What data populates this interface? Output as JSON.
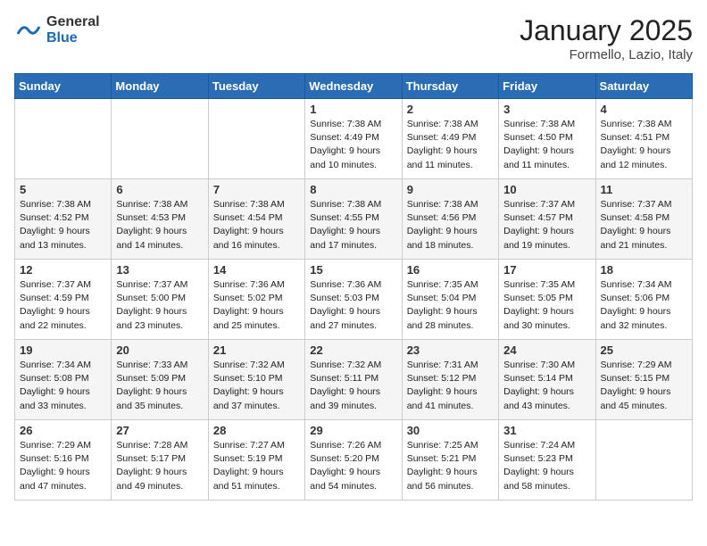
{
  "logo": {
    "general": "General",
    "blue": "Blue"
  },
  "title": "January 2025",
  "location": "Formello, Lazio, Italy",
  "days_of_week": [
    "Sunday",
    "Monday",
    "Tuesday",
    "Wednesday",
    "Thursday",
    "Friday",
    "Saturday"
  ],
  "weeks": [
    [
      {
        "day": "",
        "info": ""
      },
      {
        "day": "",
        "info": ""
      },
      {
        "day": "",
        "info": ""
      },
      {
        "day": "1",
        "info": "Sunrise: 7:38 AM\nSunset: 4:49 PM\nDaylight: 9 hours\nand 10 minutes."
      },
      {
        "day": "2",
        "info": "Sunrise: 7:38 AM\nSunset: 4:49 PM\nDaylight: 9 hours\nand 11 minutes."
      },
      {
        "day": "3",
        "info": "Sunrise: 7:38 AM\nSunset: 4:50 PM\nDaylight: 9 hours\nand 11 minutes."
      },
      {
        "day": "4",
        "info": "Sunrise: 7:38 AM\nSunset: 4:51 PM\nDaylight: 9 hours\nand 12 minutes."
      }
    ],
    [
      {
        "day": "5",
        "info": "Sunrise: 7:38 AM\nSunset: 4:52 PM\nDaylight: 9 hours\nand 13 minutes."
      },
      {
        "day": "6",
        "info": "Sunrise: 7:38 AM\nSunset: 4:53 PM\nDaylight: 9 hours\nand 14 minutes."
      },
      {
        "day": "7",
        "info": "Sunrise: 7:38 AM\nSunset: 4:54 PM\nDaylight: 9 hours\nand 16 minutes."
      },
      {
        "day": "8",
        "info": "Sunrise: 7:38 AM\nSunset: 4:55 PM\nDaylight: 9 hours\nand 17 minutes."
      },
      {
        "day": "9",
        "info": "Sunrise: 7:38 AM\nSunset: 4:56 PM\nDaylight: 9 hours\nand 18 minutes."
      },
      {
        "day": "10",
        "info": "Sunrise: 7:37 AM\nSunset: 4:57 PM\nDaylight: 9 hours\nand 19 minutes."
      },
      {
        "day": "11",
        "info": "Sunrise: 7:37 AM\nSunset: 4:58 PM\nDaylight: 9 hours\nand 21 minutes."
      }
    ],
    [
      {
        "day": "12",
        "info": "Sunrise: 7:37 AM\nSunset: 4:59 PM\nDaylight: 9 hours\nand 22 minutes."
      },
      {
        "day": "13",
        "info": "Sunrise: 7:37 AM\nSunset: 5:00 PM\nDaylight: 9 hours\nand 23 minutes."
      },
      {
        "day": "14",
        "info": "Sunrise: 7:36 AM\nSunset: 5:02 PM\nDaylight: 9 hours\nand 25 minutes."
      },
      {
        "day": "15",
        "info": "Sunrise: 7:36 AM\nSunset: 5:03 PM\nDaylight: 9 hours\nand 27 minutes."
      },
      {
        "day": "16",
        "info": "Sunrise: 7:35 AM\nSunset: 5:04 PM\nDaylight: 9 hours\nand 28 minutes."
      },
      {
        "day": "17",
        "info": "Sunrise: 7:35 AM\nSunset: 5:05 PM\nDaylight: 9 hours\nand 30 minutes."
      },
      {
        "day": "18",
        "info": "Sunrise: 7:34 AM\nSunset: 5:06 PM\nDaylight: 9 hours\nand 32 minutes."
      }
    ],
    [
      {
        "day": "19",
        "info": "Sunrise: 7:34 AM\nSunset: 5:08 PM\nDaylight: 9 hours\nand 33 minutes."
      },
      {
        "day": "20",
        "info": "Sunrise: 7:33 AM\nSunset: 5:09 PM\nDaylight: 9 hours\nand 35 minutes."
      },
      {
        "day": "21",
        "info": "Sunrise: 7:32 AM\nSunset: 5:10 PM\nDaylight: 9 hours\nand 37 minutes."
      },
      {
        "day": "22",
        "info": "Sunrise: 7:32 AM\nSunset: 5:11 PM\nDaylight: 9 hours\nand 39 minutes."
      },
      {
        "day": "23",
        "info": "Sunrise: 7:31 AM\nSunset: 5:12 PM\nDaylight: 9 hours\nand 41 minutes."
      },
      {
        "day": "24",
        "info": "Sunrise: 7:30 AM\nSunset: 5:14 PM\nDaylight: 9 hours\nand 43 minutes."
      },
      {
        "day": "25",
        "info": "Sunrise: 7:29 AM\nSunset: 5:15 PM\nDaylight: 9 hours\nand 45 minutes."
      }
    ],
    [
      {
        "day": "26",
        "info": "Sunrise: 7:29 AM\nSunset: 5:16 PM\nDaylight: 9 hours\nand 47 minutes."
      },
      {
        "day": "27",
        "info": "Sunrise: 7:28 AM\nSunset: 5:17 PM\nDaylight: 9 hours\nand 49 minutes."
      },
      {
        "day": "28",
        "info": "Sunrise: 7:27 AM\nSunset: 5:19 PM\nDaylight: 9 hours\nand 51 minutes."
      },
      {
        "day": "29",
        "info": "Sunrise: 7:26 AM\nSunset: 5:20 PM\nDaylight: 9 hours\nand 54 minutes."
      },
      {
        "day": "30",
        "info": "Sunrise: 7:25 AM\nSunset: 5:21 PM\nDaylight: 9 hours\nand 56 minutes."
      },
      {
        "day": "31",
        "info": "Sunrise: 7:24 AM\nSunset: 5:23 PM\nDaylight: 9 hours\nand 58 minutes."
      },
      {
        "day": "",
        "info": ""
      }
    ]
  ]
}
